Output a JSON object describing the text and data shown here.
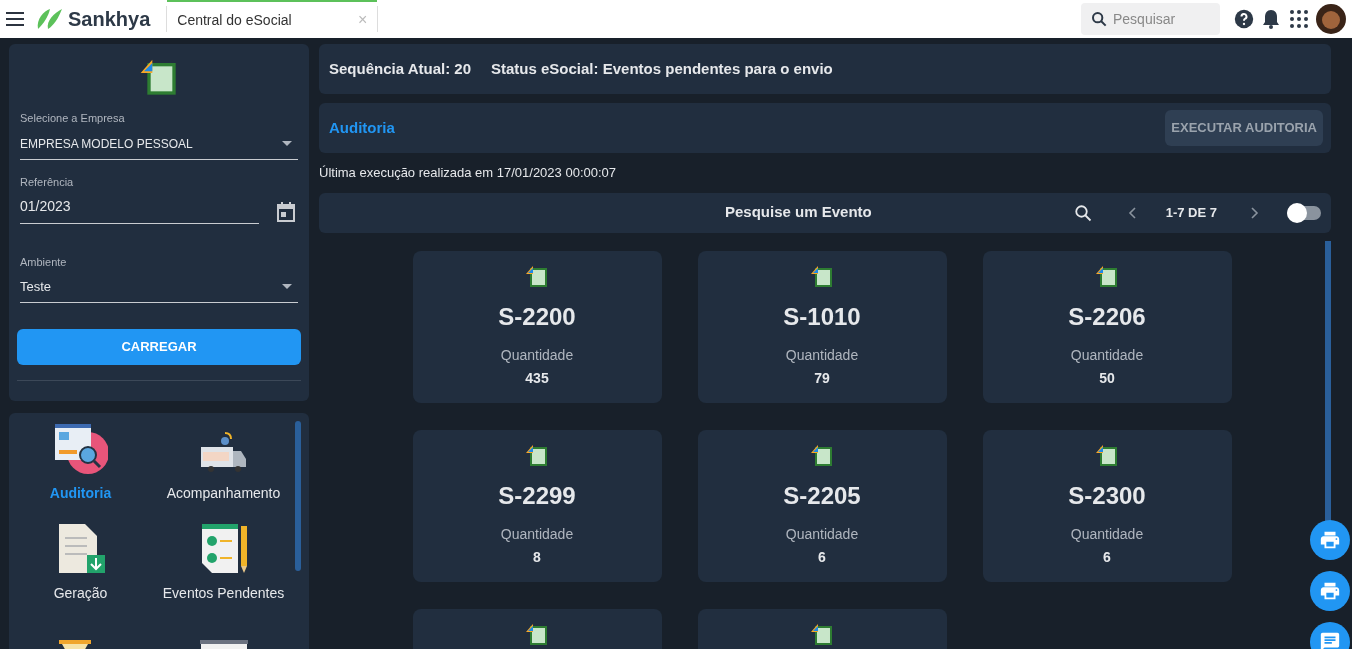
{
  "topbar": {
    "brand": "Sankhya",
    "tab": {
      "label": "Central do eSocial",
      "selected": true,
      "close": "×"
    },
    "search": {
      "placeholder": "Pesquisar"
    }
  },
  "filters": {
    "company": {
      "label": "Selecione a Empresa",
      "value": "EMPRESA MODELO PESSOAL"
    },
    "reference": {
      "label": "Referência",
      "value": "01/2023"
    },
    "environment": {
      "label": "Ambiente",
      "value": "Teste"
    },
    "load_button": "CARREGAR"
  },
  "menu": [
    {
      "kind": "audit",
      "label": "Auditoria",
      "selected": true
    },
    {
      "kind": "news",
      "label": "Acompanhamento",
      "selected": false
    },
    {
      "kind": "download",
      "label": "Geração",
      "selected": false
    },
    {
      "kind": "checklist",
      "label": "Eventos Pendentes",
      "selected": false
    },
    {
      "kind": "hourglass"
    },
    {
      "kind": "chart"
    }
  ],
  "status": {
    "sequence": "Sequência Atual: 20",
    "status": "Status eSocial: Eventos pendentes para o envio"
  },
  "audit": {
    "title": "Auditoria",
    "button": "EXECUTAR AUDITORIA",
    "last_run": "Última execução realizada em 17/01/2023 00:00:07"
  },
  "events": {
    "search_label": "Pesquise um Evento",
    "range": "1-7 DE 7",
    "toggle_on": false,
    "cards": [
      {
        "kind": "event",
        "code": "S-2200",
        "label": "Quantidade",
        "count": "435"
      },
      {
        "kind": "event",
        "code": "S-1010",
        "label": "Quantidade",
        "count": "79"
      },
      {
        "kind": "event",
        "code": "S-2206",
        "label": "Quantidade",
        "count": "50"
      },
      {
        "kind": "event",
        "code": "S-2299",
        "label": "Quantidade",
        "count": "8"
      },
      {
        "kind": "event",
        "code": "S-2205",
        "label": "Quantidade",
        "count": "6"
      },
      {
        "kind": "event",
        "code": "S-2300",
        "label": "Quantidade",
        "count": "6"
      },
      {
        "kind": "partial"
      },
      {
        "kind": "partial"
      }
    ]
  },
  "fabs": [
    {
      "kind": "print"
    },
    {
      "kind": "print"
    },
    {
      "kind": "chat"
    }
  ]
}
